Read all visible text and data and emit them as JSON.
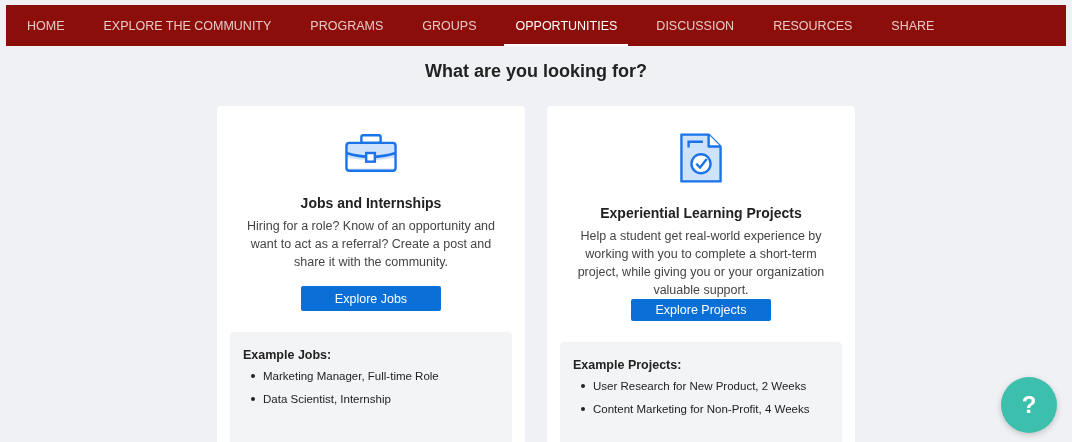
{
  "nav": {
    "items": [
      {
        "label": "HOME",
        "selected": false
      },
      {
        "label": "EXPLORE THE COMMUNITY",
        "selected": false
      },
      {
        "label": "PROGRAMS",
        "selected": false
      },
      {
        "label": "GROUPS",
        "selected": false
      },
      {
        "label": "OPPORTUNITIES",
        "selected": true
      },
      {
        "label": "DISCUSSION",
        "selected": false
      },
      {
        "label": "RESOURCES",
        "selected": false
      },
      {
        "label": "SHARE",
        "selected": false
      }
    ]
  },
  "heading": "What are you looking for?",
  "cards": [
    {
      "kind": "briefcase",
      "title": "Jobs and Internships",
      "description": "Hiring for a role? Know of an opportunity and want to act as a referral? Create a post and share it with the community.",
      "button": "Explore Jobs",
      "examples": {
        "title": "Example Jobs:",
        "items": [
          "Marketing Manager, Full-time Role",
          "Data Scientist, Internship"
        ]
      }
    },
    {
      "kind": "document",
      "title": "Experiential Learning Projects",
      "description": "Help a student get real-world experience by working with you to complete a short-term project, while giving you or your organization valuable support.",
      "button": "Explore Projects",
      "examples": {
        "title": "Example Projects:",
        "items": [
          "User Research for New Product, 2 Weeks",
          "Content Marketing for Non-Profit, 4 Weeks"
        ]
      }
    }
  ],
  "help_button": {
    "label": "?"
  }
}
